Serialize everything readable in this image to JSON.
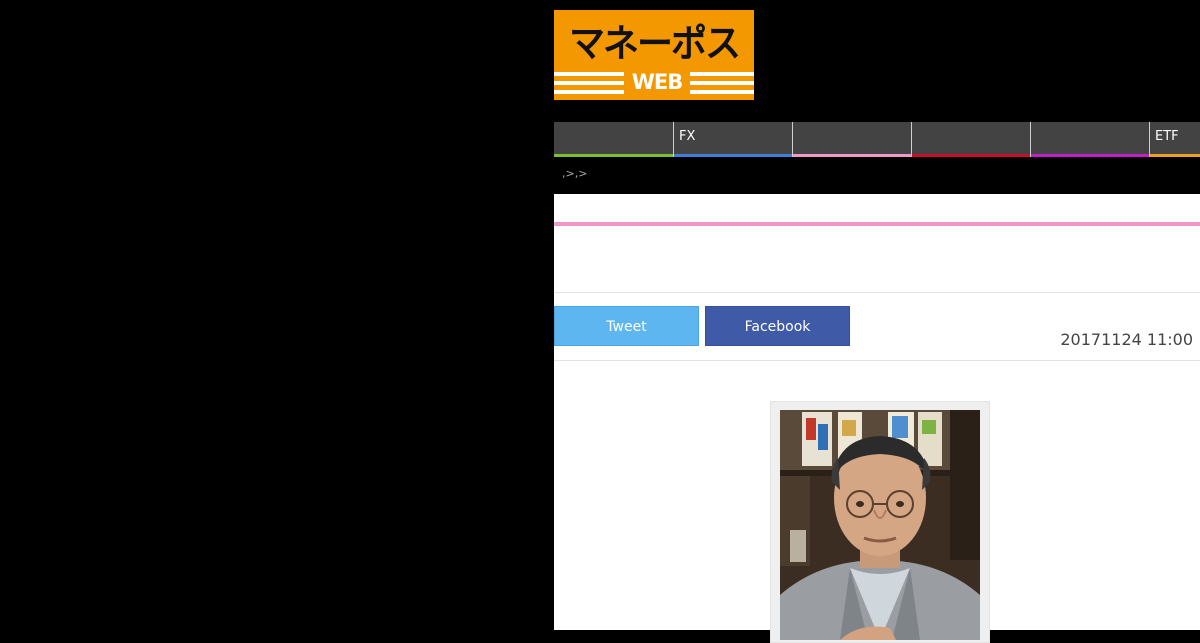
{
  "logo": {
    "text_jp": "マネーポスト",
    "text_web": "WEB"
  },
  "nav": {
    "items": [
      {
        "label": "",
        "color": "#7cc030"
      },
      {
        "label": "FX",
        "color": "#3d7fd9"
      },
      {
        "label": "",
        "color": "#f198c8"
      },
      {
        "label": "",
        "color": "#c8102e"
      },
      {
        "label": "",
        "color": "#c41fc4"
      },
      {
        "label": "ETF",
        "color": "#f0a020"
      }
    ]
  },
  "breadcrumb": {
    "text": ",>,>"
  },
  "share": {
    "tweet_label": "Tweet",
    "facebook_label": "Facebook"
  },
  "article": {
    "date": "20171124 11:00"
  },
  "colors": {
    "logo_bg": "#f39800",
    "page_bg": "#000000",
    "nav_bg": "#434343",
    "accent_pink": "#f198c8",
    "tweet": "#5eb6f0",
    "facebook": "#3f5ba8"
  },
  "icons": {
    "photo": "portrait-photo"
  }
}
